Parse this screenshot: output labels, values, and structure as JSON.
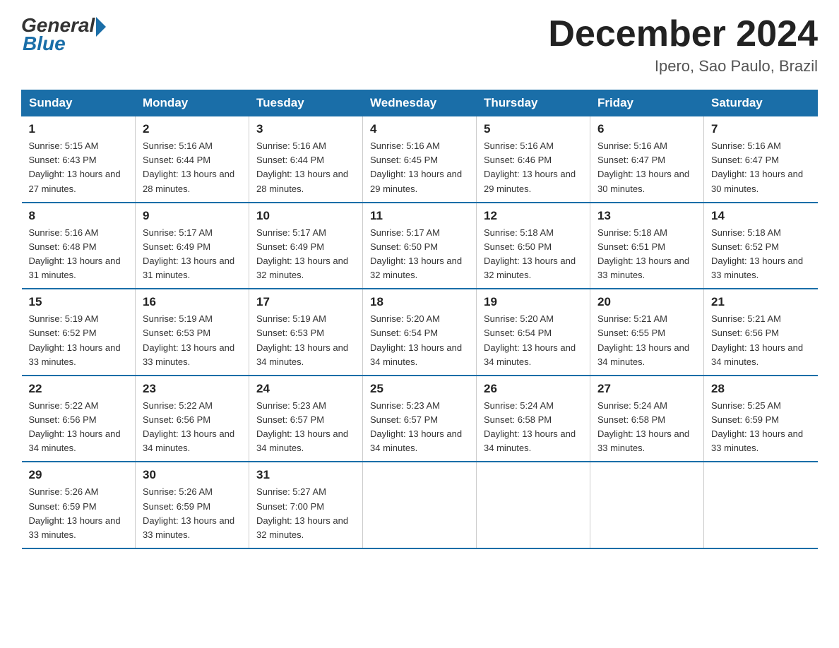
{
  "logo": {
    "general": "General",
    "blue": "Blue"
  },
  "title": "December 2024",
  "location": "Ipero, Sao Paulo, Brazil",
  "headers": [
    "Sunday",
    "Monday",
    "Tuesday",
    "Wednesday",
    "Thursday",
    "Friday",
    "Saturday"
  ],
  "weeks": [
    [
      {
        "day": "1",
        "sunrise": "5:15 AM",
        "sunset": "6:43 PM",
        "daylight": "13 hours and 27 minutes."
      },
      {
        "day": "2",
        "sunrise": "5:16 AM",
        "sunset": "6:44 PM",
        "daylight": "13 hours and 28 minutes."
      },
      {
        "day": "3",
        "sunrise": "5:16 AM",
        "sunset": "6:44 PM",
        "daylight": "13 hours and 28 minutes."
      },
      {
        "day": "4",
        "sunrise": "5:16 AM",
        "sunset": "6:45 PM",
        "daylight": "13 hours and 29 minutes."
      },
      {
        "day": "5",
        "sunrise": "5:16 AM",
        "sunset": "6:46 PM",
        "daylight": "13 hours and 29 minutes."
      },
      {
        "day": "6",
        "sunrise": "5:16 AM",
        "sunset": "6:47 PM",
        "daylight": "13 hours and 30 minutes."
      },
      {
        "day": "7",
        "sunrise": "5:16 AM",
        "sunset": "6:47 PM",
        "daylight": "13 hours and 30 minutes."
      }
    ],
    [
      {
        "day": "8",
        "sunrise": "5:16 AM",
        "sunset": "6:48 PM",
        "daylight": "13 hours and 31 minutes."
      },
      {
        "day": "9",
        "sunrise": "5:17 AM",
        "sunset": "6:49 PM",
        "daylight": "13 hours and 31 minutes."
      },
      {
        "day": "10",
        "sunrise": "5:17 AM",
        "sunset": "6:49 PM",
        "daylight": "13 hours and 32 minutes."
      },
      {
        "day": "11",
        "sunrise": "5:17 AM",
        "sunset": "6:50 PM",
        "daylight": "13 hours and 32 minutes."
      },
      {
        "day": "12",
        "sunrise": "5:18 AM",
        "sunset": "6:50 PM",
        "daylight": "13 hours and 32 minutes."
      },
      {
        "day": "13",
        "sunrise": "5:18 AM",
        "sunset": "6:51 PM",
        "daylight": "13 hours and 33 minutes."
      },
      {
        "day": "14",
        "sunrise": "5:18 AM",
        "sunset": "6:52 PM",
        "daylight": "13 hours and 33 minutes."
      }
    ],
    [
      {
        "day": "15",
        "sunrise": "5:19 AM",
        "sunset": "6:52 PM",
        "daylight": "13 hours and 33 minutes."
      },
      {
        "day": "16",
        "sunrise": "5:19 AM",
        "sunset": "6:53 PM",
        "daylight": "13 hours and 33 minutes."
      },
      {
        "day": "17",
        "sunrise": "5:19 AM",
        "sunset": "6:53 PM",
        "daylight": "13 hours and 34 minutes."
      },
      {
        "day": "18",
        "sunrise": "5:20 AM",
        "sunset": "6:54 PM",
        "daylight": "13 hours and 34 minutes."
      },
      {
        "day": "19",
        "sunrise": "5:20 AM",
        "sunset": "6:54 PM",
        "daylight": "13 hours and 34 minutes."
      },
      {
        "day": "20",
        "sunrise": "5:21 AM",
        "sunset": "6:55 PM",
        "daylight": "13 hours and 34 minutes."
      },
      {
        "day": "21",
        "sunrise": "5:21 AM",
        "sunset": "6:56 PM",
        "daylight": "13 hours and 34 minutes."
      }
    ],
    [
      {
        "day": "22",
        "sunrise": "5:22 AM",
        "sunset": "6:56 PM",
        "daylight": "13 hours and 34 minutes."
      },
      {
        "day": "23",
        "sunrise": "5:22 AM",
        "sunset": "6:56 PM",
        "daylight": "13 hours and 34 minutes."
      },
      {
        "day": "24",
        "sunrise": "5:23 AM",
        "sunset": "6:57 PM",
        "daylight": "13 hours and 34 minutes."
      },
      {
        "day": "25",
        "sunrise": "5:23 AM",
        "sunset": "6:57 PM",
        "daylight": "13 hours and 34 minutes."
      },
      {
        "day": "26",
        "sunrise": "5:24 AM",
        "sunset": "6:58 PM",
        "daylight": "13 hours and 34 minutes."
      },
      {
        "day": "27",
        "sunrise": "5:24 AM",
        "sunset": "6:58 PM",
        "daylight": "13 hours and 33 minutes."
      },
      {
        "day": "28",
        "sunrise": "5:25 AM",
        "sunset": "6:59 PM",
        "daylight": "13 hours and 33 minutes."
      }
    ],
    [
      {
        "day": "29",
        "sunrise": "5:26 AM",
        "sunset": "6:59 PM",
        "daylight": "13 hours and 33 minutes."
      },
      {
        "day": "30",
        "sunrise": "5:26 AM",
        "sunset": "6:59 PM",
        "daylight": "13 hours and 33 minutes."
      },
      {
        "day": "31",
        "sunrise": "5:27 AM",
        "sunset": "7:00 PM",
        "daylight": "13 hours and 32 minutes."
      },
      null,
      null,
      null,
      null
    ]
  ]
}
